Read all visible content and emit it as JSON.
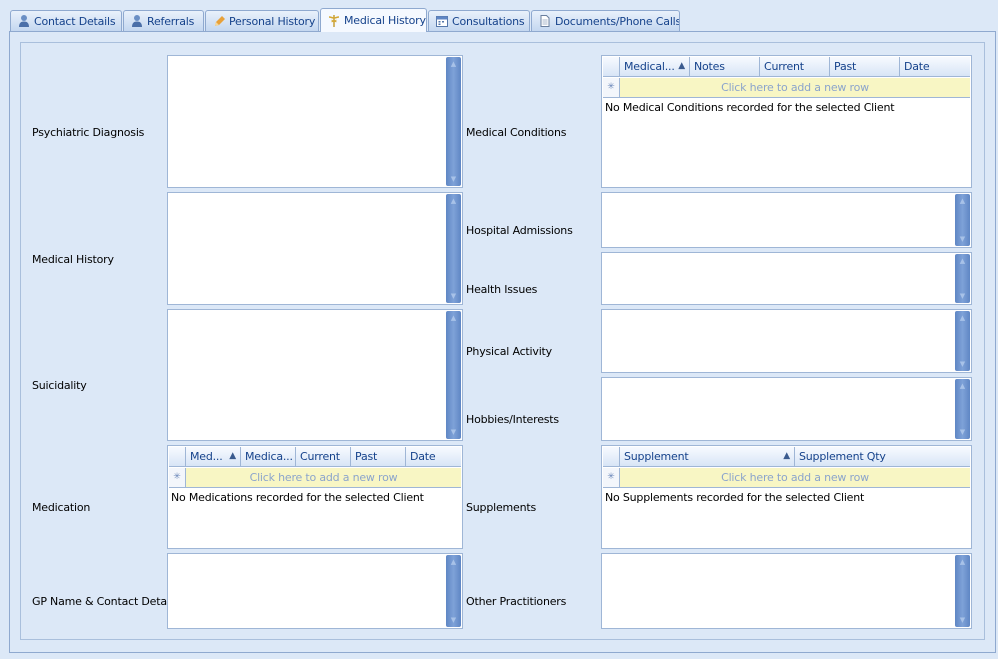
{
  "tabs": [
    {
      "label": "Contact Details",
      "icon": "person-icon"
    },
    {
      "label": "Referrals",
      "icon": "person-icon"
    },
    {
      "label": "Personal History",
      "icon": "pencil-icon"
    },
    {
      "label": "Medical History",
      "icon": "caduceus-icon"
    },
    {
      "label": "Consultations",
      "icon": "calendar-icon"
    },
    {
      "label": "Documents/Phone Calls",
      "icon": "document-icon"
    }
  ],
  "active_tab": "Medical History",
  "left_fields": {
    "psychiatric_diagnosis": "Psychiatric Diagnosis",
    "medical_history": "Medical History",
    "suicidality": "Suicidality",
    "medication": "Medication",
    "gp_name": "GP Name & Contact Details"
  },
  "right_fields": {
    "medical_conditions": "Medical Conditions",
    "hospital_admissions": "Hospital Admissions",
    "health_issues": "Health Issues",
    "physical_activity": "Physical Activity",
    "hobbies": "Hobbies/Interests",
    "supplements": "Supplements",
    "other_practitioners": "Other Practitioners"
  },
  "medication_grid": {
    "columns": [
      "Med...",
      "Medica...",
      "Current",
      "Past",
      "Date"
    ],
    "new_row": "Click here to add a new row",
    "empty": "No Medications recorded for the selected Client"
  },
  "conditions_grid": {
    "columns": [
      "Medical...",
      "Notes",
      "Current",
      "Past",
      "Date"
    ],
    "new_row": "Click here to add a new row",
    "empty": "No Medical Conditions recorded for the selected Client"
  },
  "supplements_grid": {
    "columns": [
      "Supplement",
      "Supplement Qty"
    ],
    "new_row": "Click here to add a new row",
    "empty": "No Supplements recorded for the selected Client"
  },
  "colors": {
    "background": "#dce8f7",
    "tab_text": "#15428b",
    "scrollbar": "#6f95cf",
    "new_row": "#f8f6c4"
  }
}
